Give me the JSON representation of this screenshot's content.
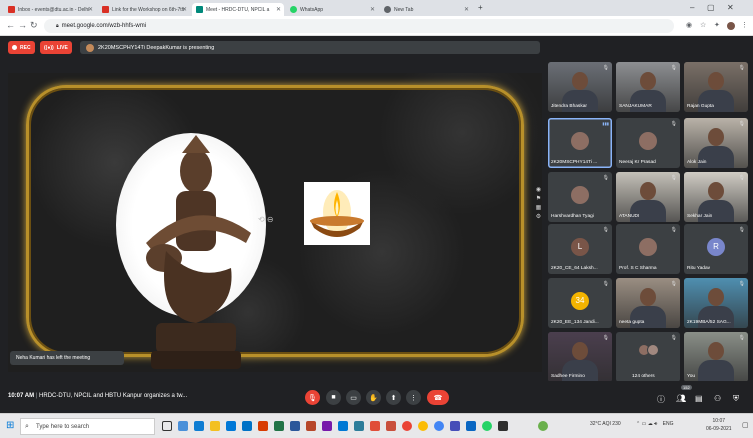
{
  "browser": {
    "tabs": [
      {
        "label": "Inbox - events@dtu.ac.in - Delhi",
        "color": "#d93025"
      },
      {
        "label": "Link for the Workshop on 6th-7th",
        "color": "#d93025"
      },
      {
        "label": "Meet - HRDC-DTU, NPCIL a",
        "color": "#00897b"
      },
      {
        "label": "WhatsApp",
        "color": "#25d366"
      },
      {
        "label": "New Tab",
        "color": "#5f6368"
      }
    ],
    "url": "meet.google.com/wzb-hhfs-wmi",
    "new_tab": "+",
    "minimize": "–",
    "maximize": "▢",
    "close": "✕"
  },
  "meet": {
    "rec_label": "REC",
    "live_label": "LIVE",
    "presenting_text": "2K20MSCPHY14Ti DeepakKumar is presenting",
    "toast": "Neha Kumari has left the meeting",
    "time": "10:07 AM",
    "meeting_title": "HRDC-DTU, NPCIL and HBTU Kanpur organizes a tw...",
    "participant_count": "152",
    "participants": [
      {
        "name": "Jitendra Bhaskar",
        "type": "cam",
        "bg": "#6b6f76"
      },
      {
        "name": "SANJAKUMAR",
        "type": "cam",
        "bg": "#8d8f92"
      },
      {
        "name": "Rajan Gupta",
        "type": "cam",
        "bg": "#7a7067"
      },
      {
        "name": "2K20MSCPHY14Ti ...",
        "type": "avatar",
        "bg": "#4a5a6a",
        "initial": "",
        "speaking": true
      },
      {
        "name": "Neeraj Kr Prasad",
        "type": "avatar",
        "bg": "#3c4043",
        "initial": ""
      },
      {
        "name": "Alok Jain",
        "type": "cam",
        "bg": "#b9b2a8"
      },
      {
        "name": "Harshvardhan Tyagi",
        "type": "avatar",
        "bg": "#3c4043",
        "initial": ""
      },
      {
        "name": "ATANUDI",
        "type": "cam",
        "bg": "#c4c0b8"
      },
      {
        "name": "Sekhar Jain",
        "type": "cam",
        "bg": "#d0ccc4"
      },
      {
        "name": "2K20_CE_64 Laksh...",
        "type": "avatar",
        "bg": "#795548",
        "initial": "L"
      },
      {
        "name": "Prof. S C Sharma",
        "type": "avatar",
        "bg": "#3c4043",
        "initial": ""
      },
      {
        "name": "Ritu Yadav",
        "type": "avatar",
        "bg": "#7986cb",
        "initial": "R"
      },
      {
        "name": "2K20_EE_134 Jandi...",
        "type": "avatar",
        "bg": "#f4b400",
        "initial": "34"
      },
      {
        "name": "neeta gupta",
        "type": "cam",
        "bg": "#9a8e82"
      },
      {
        "name": "2K19MBA/52 SAG...",
        "type": "cam",
        "bg": "#4f8fb0"
      },
      {
        "name": "Sadhee Firmino",
        "type": "cam",
        "bg": "#4b3f4e"
      },
      {
        "name": "124 others",
        "type": "others",
        "bg": "#3c4043"
      },
      {
        "name": "You",
        "type": "cam",
        "bg": "#8a8f88"
      }
    ]
  },
  "taskbar": {
    "search_placeholder": "Type here to search",
    "weather": "32°C",
    "aqi": "AQI 230",
    "lang": "ENG",
    "clock_time": "10:07",
    "clock_date": "06-09-2021"
  }
}
